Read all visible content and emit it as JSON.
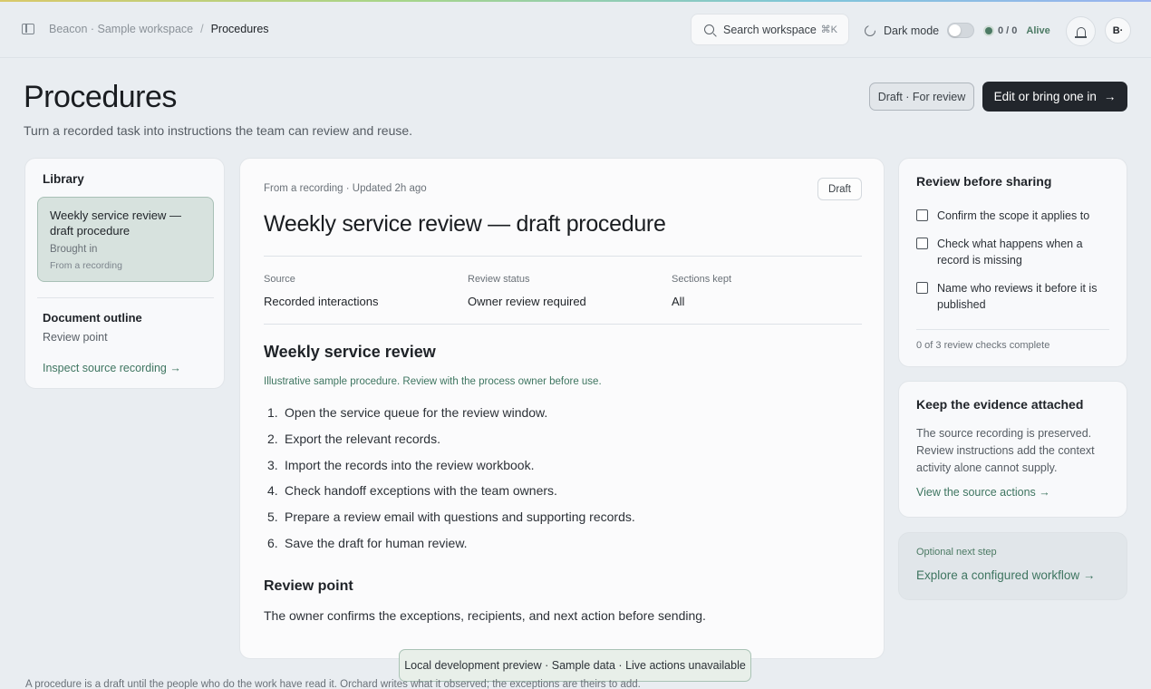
{
  "header": {
    "breadcrumb": {
      "workspace": "Beacon · Sample workspace",
      "separator": "/",
      "current": "Procedures"
    },
    "search": {
      "placeholder": "Search workspace",
      "shortcut": "⌘K"
    },
    "dark_mode_label": "Dark mode",
    "dark_mode_on": false,
    "status": {
      "count": "0 / 0",
      "state": "Alive"
    },
    "avatar_initials": "B·"
  },
  "page": {
    "title": "Procedures",
    "subtitle": "Turn a recorded task into instructions the team can review and reuse.",
    "draft_button": "Draft · For review",
    "edit_button": "Edit or bring one in",
    "edit_button_arrow": "→"
  },
  "library": {
    "title": "Library",
    "item": {
      "title": "Weekly service review — draft procedure",
      "status": "Brought in",
      "source": "From a recording"
    },
    "outline_title": "Document outline",
    "outline_items": [
      "Review point"
    ],
    "inspect_link": "Inspect source recording →"
  },
  "document": {
    "meta": "From a recording · Updated 2h ago",
    "badge": "Draft",
    "title": "Weekly service review — draft procedure",
    "fields": [
      {
        "label": "Source",
        "value": "Recorded interactions"
      },
      {
        "label": "Review status",
        "value": "Owner review required"
      },
      {
        "label": "Sections kept",
        "value": "All"
      }
    ],
    "section_heading": "Weekly service review",
    "sample_note": "Illustrative sample procedure. Review with the process owner before use.",
    "steps": [
      "Open the service queue for the review window.",
      "Export the relevant records.",
      "Import the records into the review workbook.",
      "Check handoff exceptions with the team owners.",
      "Prepare a review email with questions and supporting records.",
      "Save the draft for human review."
    ],
    "review_heading": "Review point",
    "review_text": "The owner confirms the exceptions, recipients, and next action before sending."
  },
  "checks": {
    "title": "Review before sharing",
    "items": [
      "Confirm the scope it applies to",
      "Check what happens when a record is missing",
      "Name who reviews it before it is published"
    ],
    "progress": "0 of 3 review checks complete"
  },
  "evidence": {
    "title": "Keep the evidence attached",
    "body": "The source recording is preserved. Review instructions add the context activity alone cannot supply.",
    "link": "View the source actions →"
  },
  "optional": {
    "label": "Optional next step",
    "link": "Explore a configured workflow →"
  },
  "toast": "Local development preview · Sample data · Live actions unavailable",
  "footer_note": "A procedure is a draft until the people who do the work have read it. Orchard writes what it observed; the exceptions are theirs to add.",
  "colors": {
    "accent_green": "#3e7560",
    "primary_dark": "#22262c",
    "background": "#e9edf1"
  }
}
